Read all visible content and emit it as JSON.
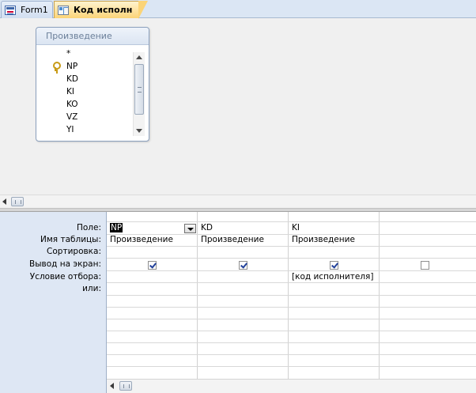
{
  "tabs": [
    {
      "label": "Form1",
      "icon": "form-icon"
    },
    {
      "label": "Код исполн",
      "icon": "query-icon",
      "active": true
    }
  ],
  "table": {
    "title": "Произведение",
    "fields": [
      {
        "name": "*",
        "key": false
      },
      {
        "name": "NP",
        "key": true
      },
      {
        "name": "KD",
        "key": false
      },
      {
        "name": "KI",
        "key": false
      },
      {
        "name": "KO",
        "key": false
      },
      {
        "name": "VZ",
        "key": false
      },
      {
        "name": "YI",
        "key": false
      }
    ]
  },
  "grid": {
    "row_labels": {
      "field": "Поле:",
      "table": "Имя таблицы:",
      "sort": "Сортировка:",
      "show": "Вывод на экран:",
      "criteria": "Условие отбора:",
      "or": "или:"
    },
    "columns": [
      {
        "field": "NP",
        "table": "Произведение",
        "sort": "",
        "show": true,
        "criteria": "",
        "or": ""
      },
      {
        "field": "KD",
        "table": "Произведение",
        "sort": "",
        "show": true,
        "criteria": "",
        "or": ""
      },
      {
        "field": "KI",
        "table": "Произведение",
        "sort": "",
        "show": true,
        "criteria": "[код исполнителя]",
        "or": ""
      },
      {
        "field": "",
        "table": "",
        "sort": "",
        "show": false,
        "criteria": "",
        "or": ""
      }
    ]
  }
}
